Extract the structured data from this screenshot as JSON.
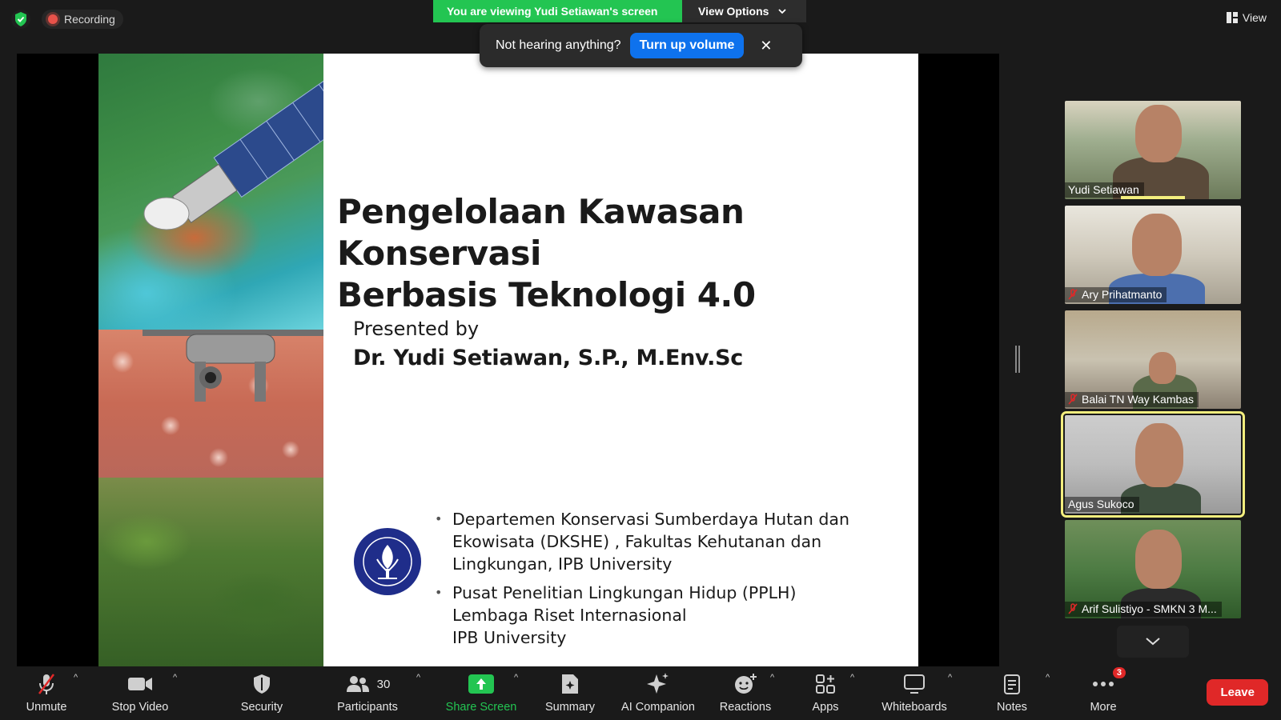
{
  "top": {
    "recording_label": "Recording",
    "viewing_banner": "You are viewing Yudi Setiawan's screen",
    "view_options_label": "View Options",
    "view_label": "View"
  },
  "toast": {
    "message": "Not hearing anything?",
    "action_label": "Turn up volume",
    "close_glyph": "✕"
  },
  "slide": {
    "title_line1": "Pengelolaan Kawasan Konservasi",
    "title_line2": "Berbasis Teknologi 4.0",
    "presented_by": "Presented by",
    "presenter": "Dr. Yudi Setiawan, S.P., M.Env.Sc",
    "affiliations": [
      {
        "line1": "Departemen Konservasi Sumberdaya Hutan dan",
        "line2": "Ekowisata (DKSHE) , Fakultas Kehutanan dan",
        "line3": "Lingkungan, IPB University"
      },
      {
        "line1": "Pusat Penelitian Lingkungan Hidup (PPLH)",
        "line2": "Lembaga Riset Internasional",
        "line3": "IPB University"
      }
    ]
  },
  "participants": [
    {
      "name": "Yudi Setiawan",
      "muted": false,
      "speaking": true
    },
    {
      "name": "Ary Prihatmanto",
      "muted": true
    },
    {
      "name": "Balai TN Way Kambas",
      "muted": true
    },
    {
      "name": "Agus Sukoco",
      "muted": false,
      "active": true
    },
    {
      "name": "Arif Sulistiyo - SMKN 3 M...",
      "muted": true
    }
  ],
  "toolbar": {
    "unmute": "Unmute",
    "stop_video": "Stop Video",
    "security": "Security",
    "participants": "Participants",
    "participants_count": "30",
    "share_screen": "Share Screen",
    "summary": "Summary",
    "ai_companion": "AI Companion",
    "reactions": "Reactions",
    "apps": "Apps",
    "whiteboards": "Whiteboards",
    "notes": "Notes",
    "more": "More",
    "more_badge": "3",
    "leave": "Leave"
  },
  "colors": {
    "share_green": "#23c552",
    "leave_red": "#e02828",
    "toast_blue": "#0e72ed",
    "active_outline": "#f3ee7e"
  }
}
